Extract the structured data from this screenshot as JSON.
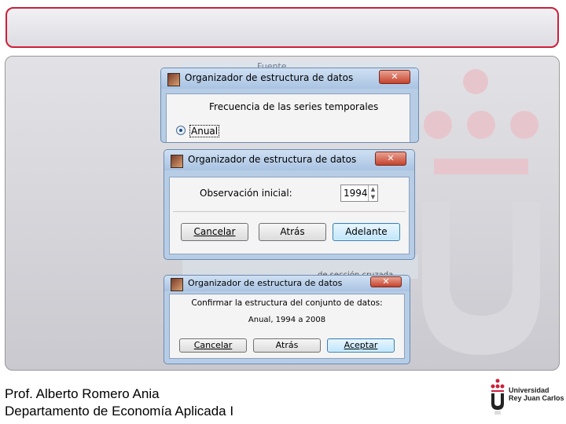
{
  "footer": {
    "line1": "Prof. Alberto Romero Ania",
    "line2": "Departamento de Economía Aplicada I"
  },
  "university": {
    "line1": "Universidad",
    "line2": "Rey Juan Carlos"
  },
  "behind_text": {
    "fuente": "Fuente",
    "seccion": "de sección cruzada"
  },
  "dialog1": {
    "title": "Organizador de estructura de datos",
    "heading": "Frecuencia de las series temporales",
    "option_label": "Anual",
    "close_glyph": "✕"
  },
  "dialog2": {
    "title": "Organizador de estructura de datos",
    "field_label": "Observación inicial:",
    "field_value": "1994",
    "cancel_label": "Cancelar",
    "back_label": "Atrás",
    "next_label": "Adelante",
    "close_glyph": "✕"
  },
  "dialog3": {
    "title": "Organizador de estructura de datos",
    "heading": "Confirmar la estructura del conjunto de datos:",
    "summary": "Anual, 1994 a 2008",
    "cancel_label": "Cancelar",
    "back_label": "Atrás",
    "accept_label": "Aceptar",
    "close_glyph": "✕"
  },
  "colors": {
    "accent_red": "#cc1f3a",
    "window_frame": "#b7cde6",
    "primary_button": "#bee6fd"
  }
}
